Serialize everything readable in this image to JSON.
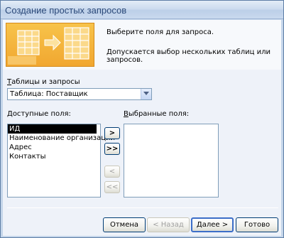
{
  "window": {
    "title": "Создание простых запросов"
  },
  "header": {
    "line1": "Выберите поля для запроса.",
    "line2": "Допускается выбор нескольких таблиц или запросов."
  },
  "source": {
    "label_prefix": "Т",
    "label_rest": "аблицы и запросы",
    "selected": "Таблица: Поставщик"
  },
  "available": {
    "label_prefix": "Д",
    "label_rest": "оступные поля:",
    "items": [
      "ИД",
      "Наименование организации",
      "Адрес",
      "Контакты"
    ],
    "selected_index": 0
  },
  "chosen": {
    "label_prefix": "В",
    "label_rest": "ыбранные поля:",
    "items": []
  },
  "move_buttons": {
    "add_one": ">",
    "add_all": ">>",
    "remove_one": "<",
    "remove_all": "<<"
  },
  "footer": {
    "cancel": "Отмена",
    "back": "< Назад",
    "next": "Далее >",
    "finish": "Готово"
  },
  "colors": {
    "title_text": "#2c4a7a",
    "window_bg": "#c4d5ea",
    "art_orange": "#f1a730"
  },
  "icons": [
    "dropdown-arrow-icon",
    "wizard-illustration"
  ]
}
